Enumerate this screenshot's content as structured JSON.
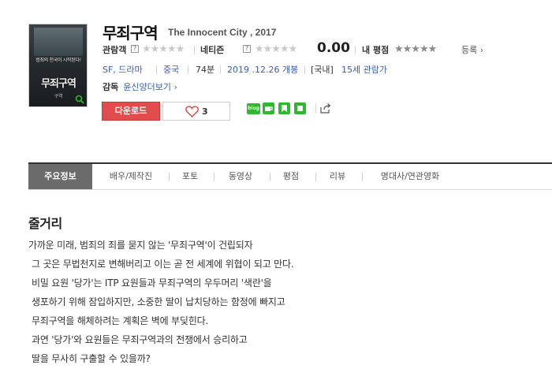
{
  "movie": {
    "title_ko": "무죄구역",
    "title_en": "The Innocent City , 2017",
    "poster": {
      "tagline": "범죄의 천국이 시작된다!",
      "title": "무죄구역",
      "subtitle": "구역"
    }
  },
  "ratings": {
    "audience_label": "관람객",
    "audience_stars": "★★★★★",
    "netizen_label": "네티즌",
    "netizen_stars": "★★★★★",
    "score": "0.00",
    "my_label": "내 평점",
    "my_stars": "★★★★★",
    "register": "등록 ›",
    "help": "?"
  },
  "info": {
    "genre": "SF, 드라마",
    "country": "중국",
    "runtime": "74분",
    "release": "2019 .12.26 개봉",
    "rating_prefix": "[국내]",
    "rating": "15세 관람가"
  },
  "director": {
    "label": "감독",
    "name": "윤신양",
    "more": "더보기 ›"
  },
  "actions": {
    "download": "다운로드",
    "like_count": "3"
  },
  "share": {
    "blog_label": "blog"
  },
  "tabs": [
    {
      "label": "주요정보"
    },
    {
      "label": "배우/제작진"
    },
    {
      "label": "포토"
    },
    {
      "label": "동영상"
    },
    {
      "label": "평점"
    },
    {
      "label": "리뷰"
    },
    {
      "label": "명대사/연관영화"
    }
  ],
  "plot": {
    "heading": "줄거리",
    "lines": [
      "가까운 미래, 범죄의 죄를 묻지 않는 '무죄구역'이 건립되자",
      "그 곳은 무법천지로 변해버리고 이는 곧 전 세계에 위협이 되고 만다.",
      "비밀 요원 '당가'는 ITP 요원들과 무죄구역의 우두머리 '색란'을",
      "생포하기 위해 잠입하지만, 소중한 딸이 납치당하는 함정에 빠지고",
      "무죄구역을 해체하려는 계획은 벽에 부딪힌다.",
      "과연 '당가'와 요원들은 무죄구역과의 전쟁에서 승리하고",
      "딸을 무사히 구출할 수 있을까?"
    ]
  },
  "colors": {
    "accent_red": "#e14c4c",
    "link_blue": "#3a5fa8",
    "tab_active": "#6b6b6b",
    "share_green": "#2eb82e"
  }
}
